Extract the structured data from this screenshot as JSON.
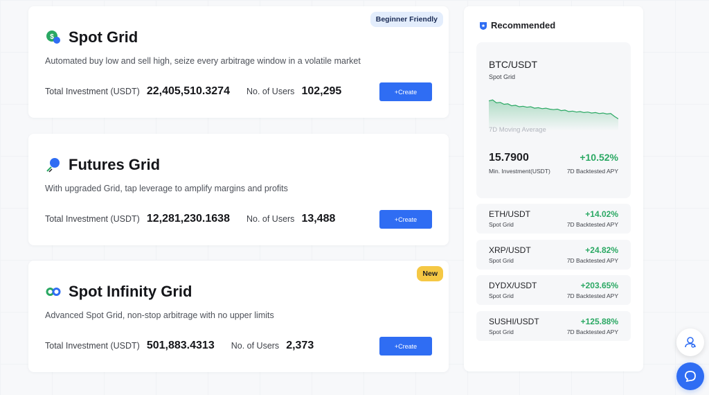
{
  "colors": {
    "accent": "#2f6df3",
    "positive": "#2aa863",
    "badge_blue_bg": "#e3edfc",
    "badge_yellow_bg": "#f5c844"
  },
  "cards": [
    {
      "icon": "dollar-coin-icon",
      "title": "Spot Grid",
      "description": "Automated buy low and sell high, seize every arbitrage window in a volatile market",
      "investment_label": "Total Investment (USDT)",
      "investment_value": "22,405,510.3274",
      "users_label": "No. of Users",
      "users_value": "102,295",
      "create_label": "+Create",
      "badge": "Beginner Friendly"
    },
    {
      "icon": "futures-grid-icon",
      "title": "Futures Grid",
      "description": "With upgraded Grid, tap leverage to amplify margins and profits",
      "investment_label": "Total Investment (USDT)",
      "investment_value": "12,281,230.1638",
      "users_label": "No. of Users",
      "users_value": "13,488",
      "create_label": "+Create",
      "badge": ""
    },
    {
      "icon": "infinity-icon",
      "title": "Spot Infinity Grid",
      "description": "Advanced Spot Grid, non-stop arbitrage with no upper limits",
      "investment_label": "Total Investment (USDT)",
      "investment_value": "501,883.4313",
      "users_label": "No. of Users",
      "users_value": "2,373",
      "create_label": "+Create",
      "badge": "New"
    }
  ],
  "recommended": {
    "heading": "Recommended",
    "featured": {
      "pair": "BTC/USDT",
      "type": "Spot Grid",
      "chart_caption": "7D Moving Average",
      "min_investment_value": "15.7900",
      "min_investment_label": "Min. Investment(USDT)",
      "apy_value": "+10.52%",
      "apy_label": "7D Backtested APY",
      "sparkline": [
        0.62,
        0.64,
        0.58,
        0.59,
        0.55,
        0.56,
        0.52,
        0.53,
        0.5,
        0.51,
        0.49,
        0.5,
        0.47,
        0.48,
        0.46,
        0.47,
        0.45,
        0.44,
        0.45,
        0.42,
        0.43,
        0.4,
        0.41,
        0.39,
        0.4,
        0.38,
        0.39,
        0.37,
        0.38,
        0.36,
        0.37,
        0.35,
        0.36,
        0.3,
        0.25
      ]
    },
    "items": [
      {
        "pair": "ETH/USDT",
        "type": "Spot Grid",
        "apy": "+14.02%",
        "apy_label": "7D Backtested APY"
      },
      {
        "pair": "XRP/USDT",
        "type": "Spot Grid",
        "apy": "+24.82%",
        "apy_label": "7D Backtested APY"
      },
      {
        "pair": "DYDX/USDT",
        "type": "Spot Grid",
        "apy": "+203.65%",
        "apy_label": "7D Backtested APY"
      },
      {
        "pair": "SUSHI/USDT",
        "type": "Spot Grid",
        "apy": "+125.88%",
        "apy_label": "7D Backtested APY"
      }
    ]
  },
  "floating": {
    "support_icon": "support-agent-icon",
    "chat_icon": "chat-bubble-icon"
  }
}
